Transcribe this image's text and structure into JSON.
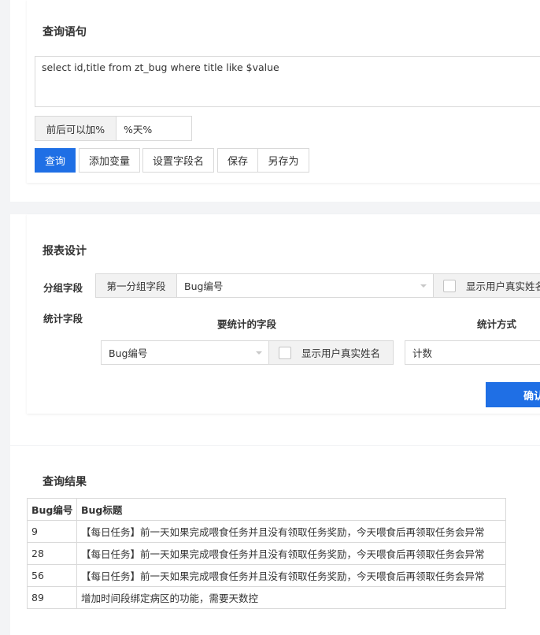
{
  "query": {
    "title": "查询语句",
    "sql": "select id,title from zt_bug where title like $value",
    "var_prefix": "前后可以加%",
    "var_value": "%天%",
    "buttons": {
      "query": "查询",
      "add_variable": "添加变量",
      "set_field_name": "设置字段名",
      "save": "保存",
      "save_as": "另存为"
    }
  },
  "report": {
    "title": "报表设计",
    "group_label": "分组字段",
    "group_first_label": "第一分组字段",
    "group_first_value": "Bug编号",
    "group_show_realname": "显示用户真实姓名",
    "stat_label": "统计字段",
    "stat_field_header": "要统计的字段",
    "stat_method_header": "统计方式",
    "stat_field_value": "Bug编号",
    "stat_show_realname": "显示用户真实姓名",
    "stat_method_value": "计数",
    "confirm": "确认"
  },
  "result": {
    "title": "查询结果",
    "columns": [
      "Bug编号",
      "Bug标题"
    ],
    "rows": [
      [
        "9",
        "【每日任务】前一天如果完成喂食任务并且没有领取任务奖励，今天喂食后再领取任务会异常"
      ],
      [
        "28",
        "【每日任务】前一天如果完成喂食任务并且没有领取任务奖励，今天喂食后再领取任务会异常"
      ],
      [
        "56",
        "【每日任务】前一天如果完成喂食任务并且没有领取任务奖励，今天喂食后再领取任务会异常"
      ],
      [
        "89",
        "增加时间段绑定病区的功能，需要天数控"
      ]
    ]
  }
}
